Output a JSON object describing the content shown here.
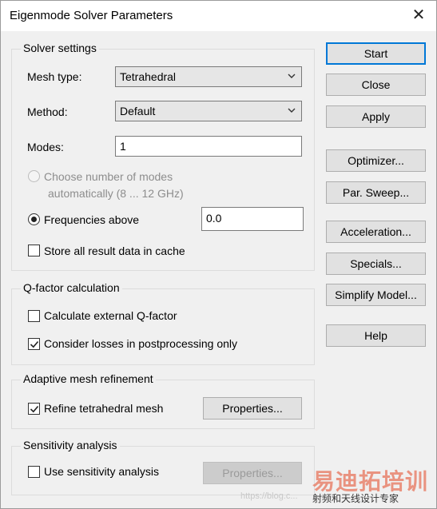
{
  "window": {
    "title": "Eigenmode Solver Parameters",
    "close_icon": "close-icon"
  },
  "solver_settings": {
    "legend": "Solver settings",
    "mesh_type_label": "Mesh type:",
    "mesh_type_value": "Tetrahedral",
    "method_label": "Method:",
    "method_value": "Default",
    "modes_label": "Modes:",
    "modes_value": "1",
    "choose_modes_label": "Choose number of modes",
    "choose_modes_sub": "automatically (8 ... 12 GHz)",
    "frequencies_above_label": "Frequencies above",
    "frequencies_above_value": "0.0",
    "store_cache_label": "Store all result data in cache",
    "choose_modes_selected": false,
    "frequencies_above_selected": true,
    "store_cache_checked": false
  },
  "qfactor": {
    "legend": "Q-factor calculation",
    "external_label": "Calculate external Q-factor",
    "external_checked": false,
    "losses_label": "Consider losses in postprocessing only",
    "losses_checked": true
  },
  "adaptive": {
    "legend": "Adaptive mesh refinement",
    "refine_label": "Refine tetrahedral mesh",
    "refine_checked": true,
    "properties_label": "Properties..."
  },
  "sensitivity": {
    "legend": "Sensitivity analysis",
    "use_label": "Use sensitivity analysis",
    "use_checked": false,
    "properties_label": "Properties..."
  },
  "buttons": {
    "start": "Start",
    "close": "Close",
    "apply": "Apply",
    "optimizer": "Optimizer...",
    "par_sweep": "Par. Sweep...",
    "acceleration": "Acceleration...",
    "specials": "Specials...",
    "simplify_model": "Simplify Model...",
    "help": "Help"
  },
  "watermark": {
    "brand": "易迪拓培训",
    "tagline": "射频和天线设计专家",
    "url": "https://blog.c..."
  }
}
